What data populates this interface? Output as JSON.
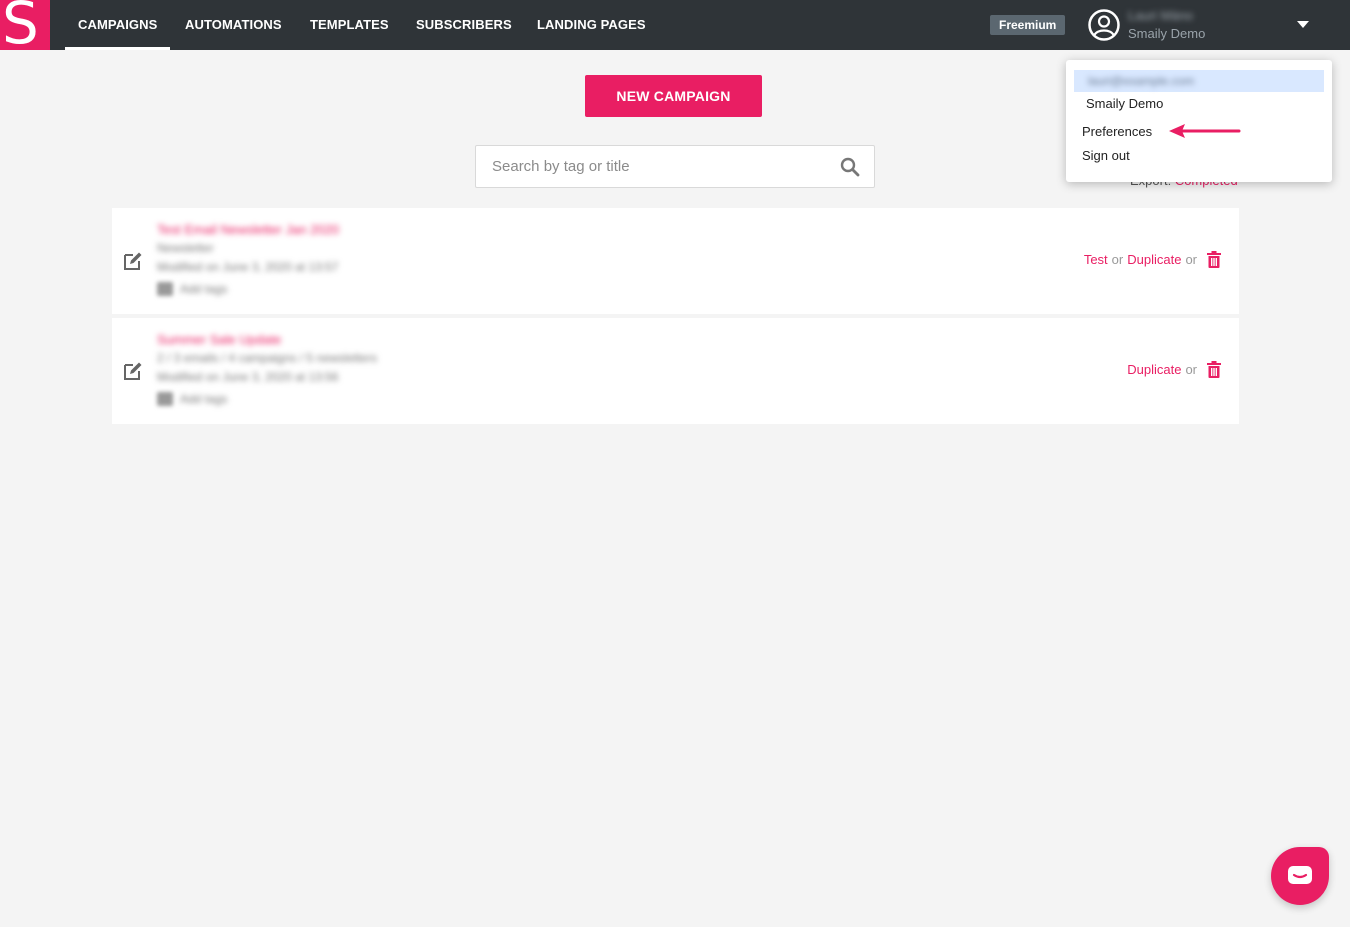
{
  "nav": {
    "logo_letter": "S",
    "items": [
      {
        "label": "CAMPAIGNS",
        "active": true
      },
      {
        "label": "AUTOMATIONS"
      },
      {
        "label": "TEMPLATES"
      },
      {
        "label": "SUBSCRIBERS"
      },
      {
        "label": "LANDING PAGES"
      }
    ],
    "plan_badge": "Freemium",
    "user_name": "Lauri Mäno",
    "user_org": "Smaily Demo"
  },
  "main": {
    "new_campaign_label": "NEW CAMPAIGN",
    "search_placeholder": "Search by tag or title",
    "export_label": "Export:",
    "export_status": "Completed"
  },
  "campaigns": [
    {
      "title": "Test Email Newsletter Jan 2020",
      "subtitle": "Newsletter",
      "modified": "Modified on June 3, 2020 at 13:57",
      "tags": "Add tags",
      "actions": {
        "test": "Test",
        "or1": "or",
        "duplicate": "Duplicate",
        "or2": "or"
      }
    },
    {
      "title": "Summer Sale Update",
      "subtitle": "2 / 3 emails / 4 campaigns / 5 newsletters",
      "modified": "Modified on June 3, 2020 at 13:56",
      "tags": "Add tags",
      "actions": {
        "duplicate": "Duplicate",
        "or2": "or"
      }
    }
  ],
  "dropdown": {
    "email": "lauri@example.com",
    "org": "Smaily Demo",
    "preferences": "Preferences",
    "sign_out": "Sign out"
  },
  "colors": {
    "brand": "#e91e63",
    "topbar": "#2f3438",
    "background": "#f4f4f4"
  },
  "icons": {
    "search": "search-icon",
    "edit": "edit-icon",
    "trash": "trash-icon",
    "chat": "chat-icon",
    "avatar": "user-avatar-icon"
  }
}
